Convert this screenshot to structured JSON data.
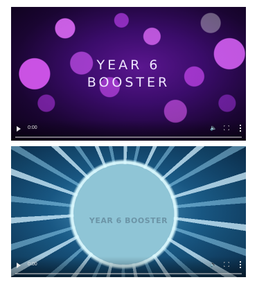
{
  "videos": [
    {
      "title": "YEAR 6\nBOOSTER",
      "time": "0:00",
      "progress": 0
    },
    {
      "title": "YEAR 6 BOOSTER",
      "time": "0:00",
      "progress": 0
    }
  ],
  "icons": {
    "play": "play-icon",
    "volume": "volume-icon",
    "fullscreen": "fullscreen-icon",
    "more": "more-options-icon"
  },
  "colors": {
    "video1_accent": "#b84be6",
    "video2_accent": "#57a5d0"
  }
}
